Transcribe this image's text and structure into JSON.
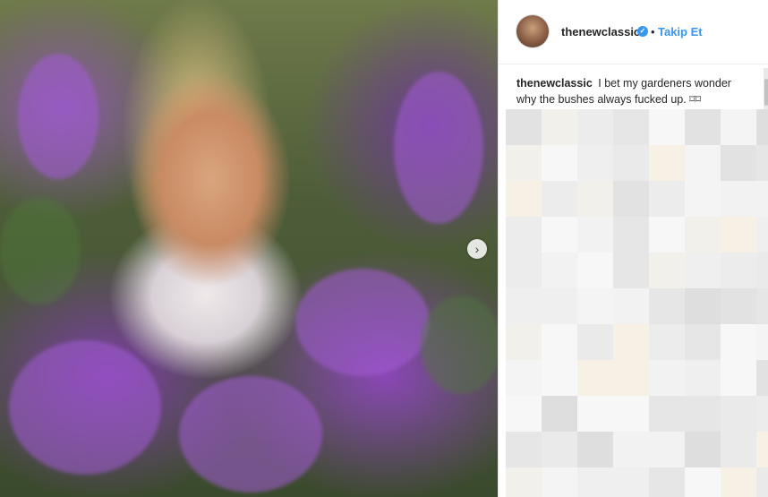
{
  "post": {
    "image_alt": "",
    "next_icon": "chevron-right-icon",
    "next_symbol": "›"
  },
  "header": {
    "username": "thenewclassic",
    "verified_symbol": "✓",
    "separator": "•",
    "follow_label": "Takip Et"
  },
  "caption": {
    "username": "thenewclassic",
    "text": "I bet my gardeners wonder why the bushes always fucked up. ⌑⌑"
  },
  "colors": {
    "link": "#3897f0",
    "text": "#262626"
  }
}
